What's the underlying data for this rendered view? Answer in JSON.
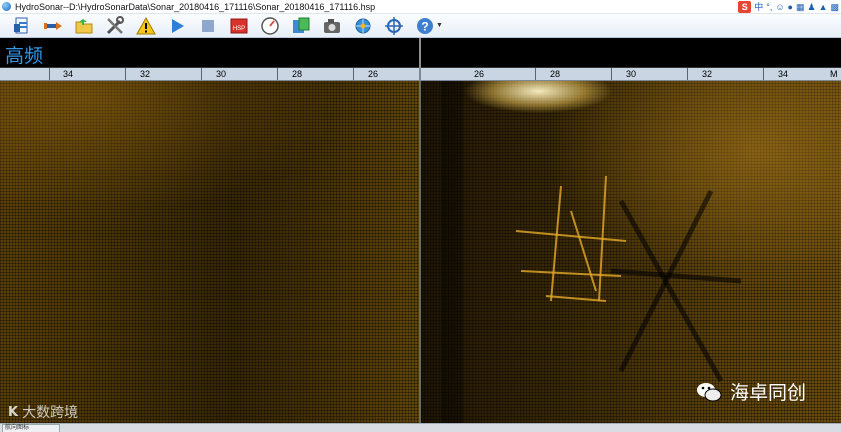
{
  "window": {
    "title": "HydroSonar--D:\\HydroSonarData\\Sonar_20180416_171116\\Sonar_20180416_171116.hsp"
  },
  "ime": {
    "logo": "S",
    "lang": "中",
    "punct": "°,",
    "smiley": "☺",
    "mic": "🎤",
    "keyboard": "⌨"
  },
  "toolbar": {
    "items": [
      {
        "name": "open-file-icon"
      },
      {
        "name": "pointer-tool-icon"
      },
      {
        "name": "folder-icon"
      },
      {
        "name": "tools-icon"
      },
      {
        "name": "warning-icon"
      },
      {
        "name": "play-icon"
      },
      {
        "name": "stop-icon"
      },
      {
        "name": "hsp-save-icon",
        "label": "HSP"
      },
      {
        "name": "gauge-icon"
      },
      {
        "name": "export-icon"
      },
      {
        "name": "camera-icon"
      },
      {
        "name": "globe-settings-icon"
      },
      {
        "name": "target-icon"
      },
      {
        "name": "help-icon"
      }
    ]
  },
  "banner": {
    "channel_label": "高频"
  },
  "ruler": {
    "left_ticks": [
      "34",
      "32",
      "30",
      "28",
      "26"
    ],
    "right_ticks": [
      "26",
      "28",
      "30",
      "32",
      "34"
    ],
    "unit": "M"
  },
  "colors": {
    "sonar": "#5a400b",
    "accent": "#2f98e8"
  },
  "status": {
    "cell": "航向图标"
  },
  "watermarks": {
    "left": "大数跨境",
    "left_logo": "K",
    "right": "海卓同创"
  }
}
